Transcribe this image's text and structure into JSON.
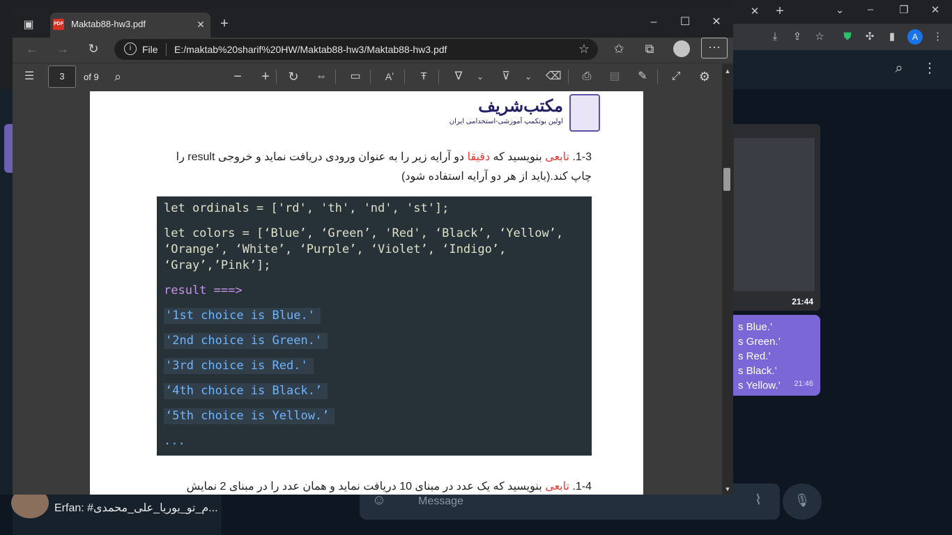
{
  "edge": {
    "tab_title": "Maktab88-hw3.pdf",
    "address_scheme": "File",
    "address_url": "E:/maktab%20sharif%20HW/Maktab88-hw3/Maktab88-hw3.pdf",
    "pdf_page_number": "3",
    "pdf_page_of": "of 9",
    "icons": [
      "sidebar-icon",
      "pdf-icon",
      "close-icon",
      "plus-icon",
      "back-icon",
      "forward-icon",
      "refresh-icon",
      "info-icon",
      "favorite-add-icon",
      "favorites-icon",
      "collections-icon",
      "profile-icon",
      "more-icon",
      "minimize-icon",
      "restore-icon",
      "contents-icon",
      "search-icon",
      "zoom-out-icon",
      "zoom-in-icon",
      "rotate-icon",
      "fit-width-icon",
      "page-view-icon",
      "read-aloud-icon",
      "text-icon",
      "draw-icon",
      "highlight-icon",
      "eraser-icon",
      "print-icon",
      "save-icon",
      "save-as-icon",
      "fullscreen-icon",
      "settings-icon"
    ]
  },
  "pdf": {
    "logo_title": "مکتب‌شریف",
    "logo_subtitle": "اولین بوتکمپ آموزشی-استخدامی ایران",
    "q1_number": "1-3.",
    "q1_red_1": "تابعی",
    "q1_t1": "بنویسید که",
    "q1_red_2": "دقیقا",
    "q1_t2": "دو آرایه زیر را به عنوان ورودی دریافت نماید و خروجی result را",
    "q1_line2": "چاپ کند.(باید از هر دو آرایه استفاده شود)",
    "code": {
      "ordinals": "let ordinals = ['rd', 'th', 'nd', 'st'];",
      "colors": "let colors = [‘Blue’, ‘Green’, 'Red', ‘Black’, ‘Yellow’,\n‘Orange’, ‘White’, ‘Purple’, ‘Violet’, ‘Indigo’,\n‘Gray’,’Pink’];",
      "result_label": "result ===>",
      "outputs": [
        "'1st choice is Blue.'",
        "'2nd choice is Green.'",
        "'3rd choice is Red.'",
        "‘4th choice is Black.’",
        "‘5th choice is Yellow.’"
      ],
      "ellipsis": "..."
    },
    "q2_number": "1-4.",
    "q2_red": "تابعی",
    "q2_text": "بنویسید که یک عدد در مبنای 10 دریافت نماید و همان عدد را در مبنای 2 نمایش"
  },
  "telegram": {
    "media_time": "21:44",
    "bubble_lines": [
      "s Blue.’",
      "s Green.’",
      "s Red.’",
      "s Black.’",
      "s Yellow.’"
    ],
    "bubble_time": "21:46",
    "last_message": "Erfan: #م_تو_یوریا_علی_محمدی...",
    "input_placeholder": "Message"
  },
  "colors": {
    "accent_red": "#e53935",
    "code_bg": "#263238",
    "bubble": "#7b68d6",
    "logo": "#231f66"
  }
}
